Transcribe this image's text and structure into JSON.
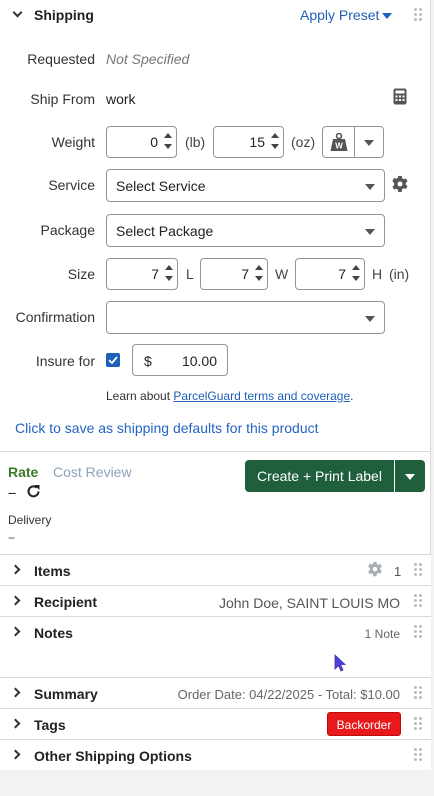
{
  "header": {
    "title": "Shipping",
    "apply_preset": "Apply Preset"
  },
  "form": {
    "requested_label": "Requested",
    "requested_value": "Not Specified",
    "ship_from_label": "Ship From",
    "ship_from_value": "work",
    "weight_label": "Weight",
    "weight_lb": "0",
    "weight_lb_unit": "(lb)",
    "weight_oz": "15",
    "weight_oz_unit": "(oz)",
    "service_label": "Service",
    "service_value": "Select Service",
    "package_label": "Package",
    "package_value": "Select Package",
    "size_label": "Size",
    "size_l": "7",
    "size_l_unit": "L",
    "size_w": "7",
    "size_w_unit": "W",
    "size_h": "7",
    "size_h_unit": "H",
    "size_unit": "(in)",
    "confirmation_label": "Confirmation",
    "confirmation_value": "",
    "insure_label": "Insure for",
    "insure_checked": true,
    "insure_currency": "$",
    "insure_amount": "10.00",
    "learn_prefix": "Learn about ",
    "learn_link": "ParcelGuard terms and coverage",
    "learn_suffix": ".",
    "save_defaults": "Click to save as shipping defaults for this product"
  },
  "rate": {
    "rate_tab": "Rate",
    "cost_review_tab": "Cost Review",
    "rate_value": "--",
    "delivery_label": "Delivery",
    "delivery_value": "--",
    "create_label": "Create + Print Label"
  },
  "sections": {
    "items": {
      "title": "Items",
      "count": "1"
    },
    "recipient": {
      "title": "Recipient",
      "value": "John Doe, SAINT LOUIS MO"
    },
    "notes": {
      "title": "Notes",
      "value": "1 Note"
    },
    "summary": {
      "title": "Summary",
      "value": "Order Date: 04/22/2025 - Total: $10.00"
    },
    "tags": {
      "title": "Tags",
      "badge": "Backorder"
    },
    "other": {
      "title": "Other Shipping Options"
    }
  },
  "colors": {
    "accent_blue": "#1f5fb8",
    "rate_green": "#3d7a2a",
    "create_button": "#1f5f3c",
    "badge_red": "#e8191b",
    "link_blue": "#2464c4"
  }
}
